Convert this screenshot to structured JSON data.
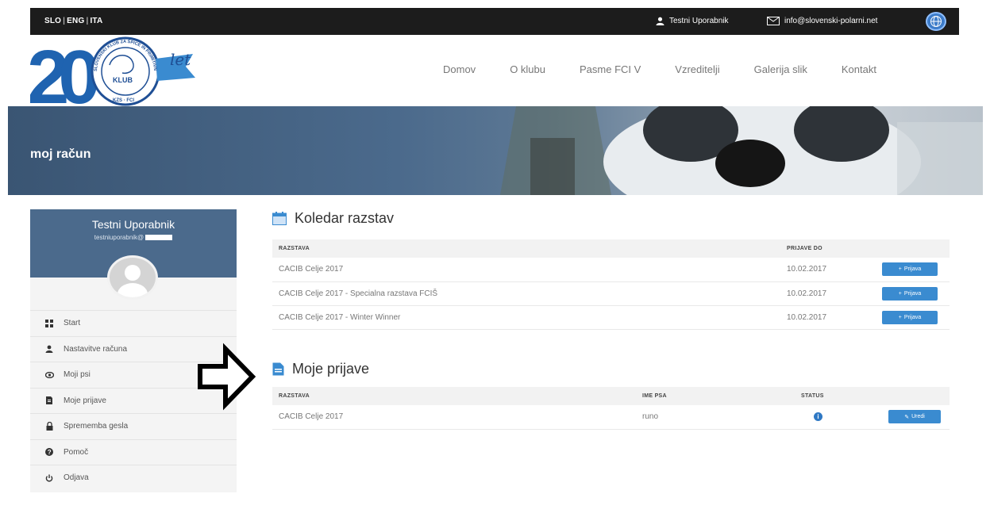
{
  "topbar": {
    "lang": [
      "SLO",
      "ENG",
      "ITA"
    ],
    "user": "Testni Uporabnik",
    "email": "info@slovenski-polarni.net",
    "icons": {
      "user": "user-icon",
      "mail": "envelope-icon",
      "globe": "globe-icon"
    }
  },
  "logo": {
    "number": "20",
    "suffix": "let",
    "ring_text": "SLOVENSKI KLUB ZA ŠPICE IN PRIMITIVNE PSE",
    "center": "KLUB",
    "bottom": "KZS · FCI"
  },
  "nav": [
    "Domov",
    "O klubu",
    "Pasme FCI V",
    "Vzreditelji",
    "Galerija slik",
    "Kontakt"
  ],
  "banner": {
    "title": "moj račun"
  },
  "sidebar": {
    "name": "Testni Uporabnik",
    "email": "testniuporabnik@",
    "menu": [
      {
        "label": "Start",
        "icon": "grid-icon"
      },
      {
        "label": "Nastavitve računa",
        "icon": "user-icon"
      },
      {
        "label": "Moji psi",
        "icon": "eye-icon"
      },
      {
        "label": "Moje prijave",
        "icon": "file-icon"
      },
      {
        "label": "Sprememba gesla",
        "icon": "lock-icon"
      },
      {
        "label": "Pomoč",
        "icon": "question-icon"
      },
      {
        "label": "Odjava",
        "icon": "power-icon"
      }
    ]
  },
  "calendar": {
    "title": "Koledar razstav",
    "col_show": "RAZSTAVA",
    "col_deadline": "PRIJAVE DO",
    "rows": [
      {
        "show": "CACIB Celje 2017",
        "deadline": "10.02.2017",
        "button": "Prijava"
      },
      {
        "show": "CACIB Celje 2017 - Specialna razstava FCIŠ",
        "deadline": "10.02.2017",
        "button": "Prijava"
      },
      {
        "show": "CACIB Celje 2017 - Winter Winner",
        "deadline": "10.02.2017",
        "button": "Prijava"
      }
    ]
  },
  "entries": {
    "title": "Moje prijave",
    "col_show": "RAZSTAVA",
    "col_dog": "IME PSA",
    "col_status": "STATUS",
    "rows": [
      {
        "show": "CACIB Celje 2017",
        "dog": "runo",
        "status_icon": "info-icon",
        "button": "Uredi"
      }
    ]
  }
}
